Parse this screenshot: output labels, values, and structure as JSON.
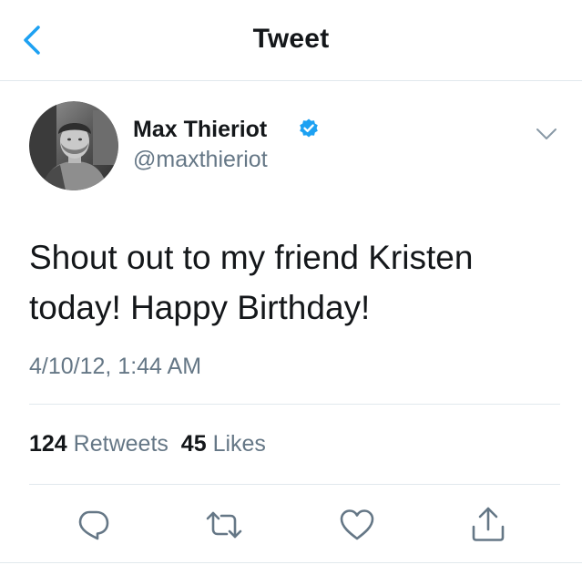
{
  "header": {
    "title": "Tweet",
    "back_icon": "chevron-left-icon"
  },
  "tweet": {
    "author": {
      "name": "Max Thieriot",
      "handle": "@maxthieriot",
      "verified": true
    },
    "text_lines": [
      "Shout out to my friend Kristen",
      "today! Happy Birthday!"
    ],
    "timestamp": "4/10/12, 1:44 AM",
    "stats": {
      "retweets_count": "124",
      "retweets_label": "Retweets",
      "likes_count": "45",
      "likes_label": "Likes"
    }
  },
  "actions": {
    "icons": [
      "reply-icon",
      "retweet-icon",
      "like-icon",
      "share-icon"
    ]
  },
  "colors": {
    "accent": "#1da1f2",
    "text": "#14171a",
    "secondary_text": "#657786",
    "divider": "#e1e8ed",
    "icon": "#657786"
  }
}
